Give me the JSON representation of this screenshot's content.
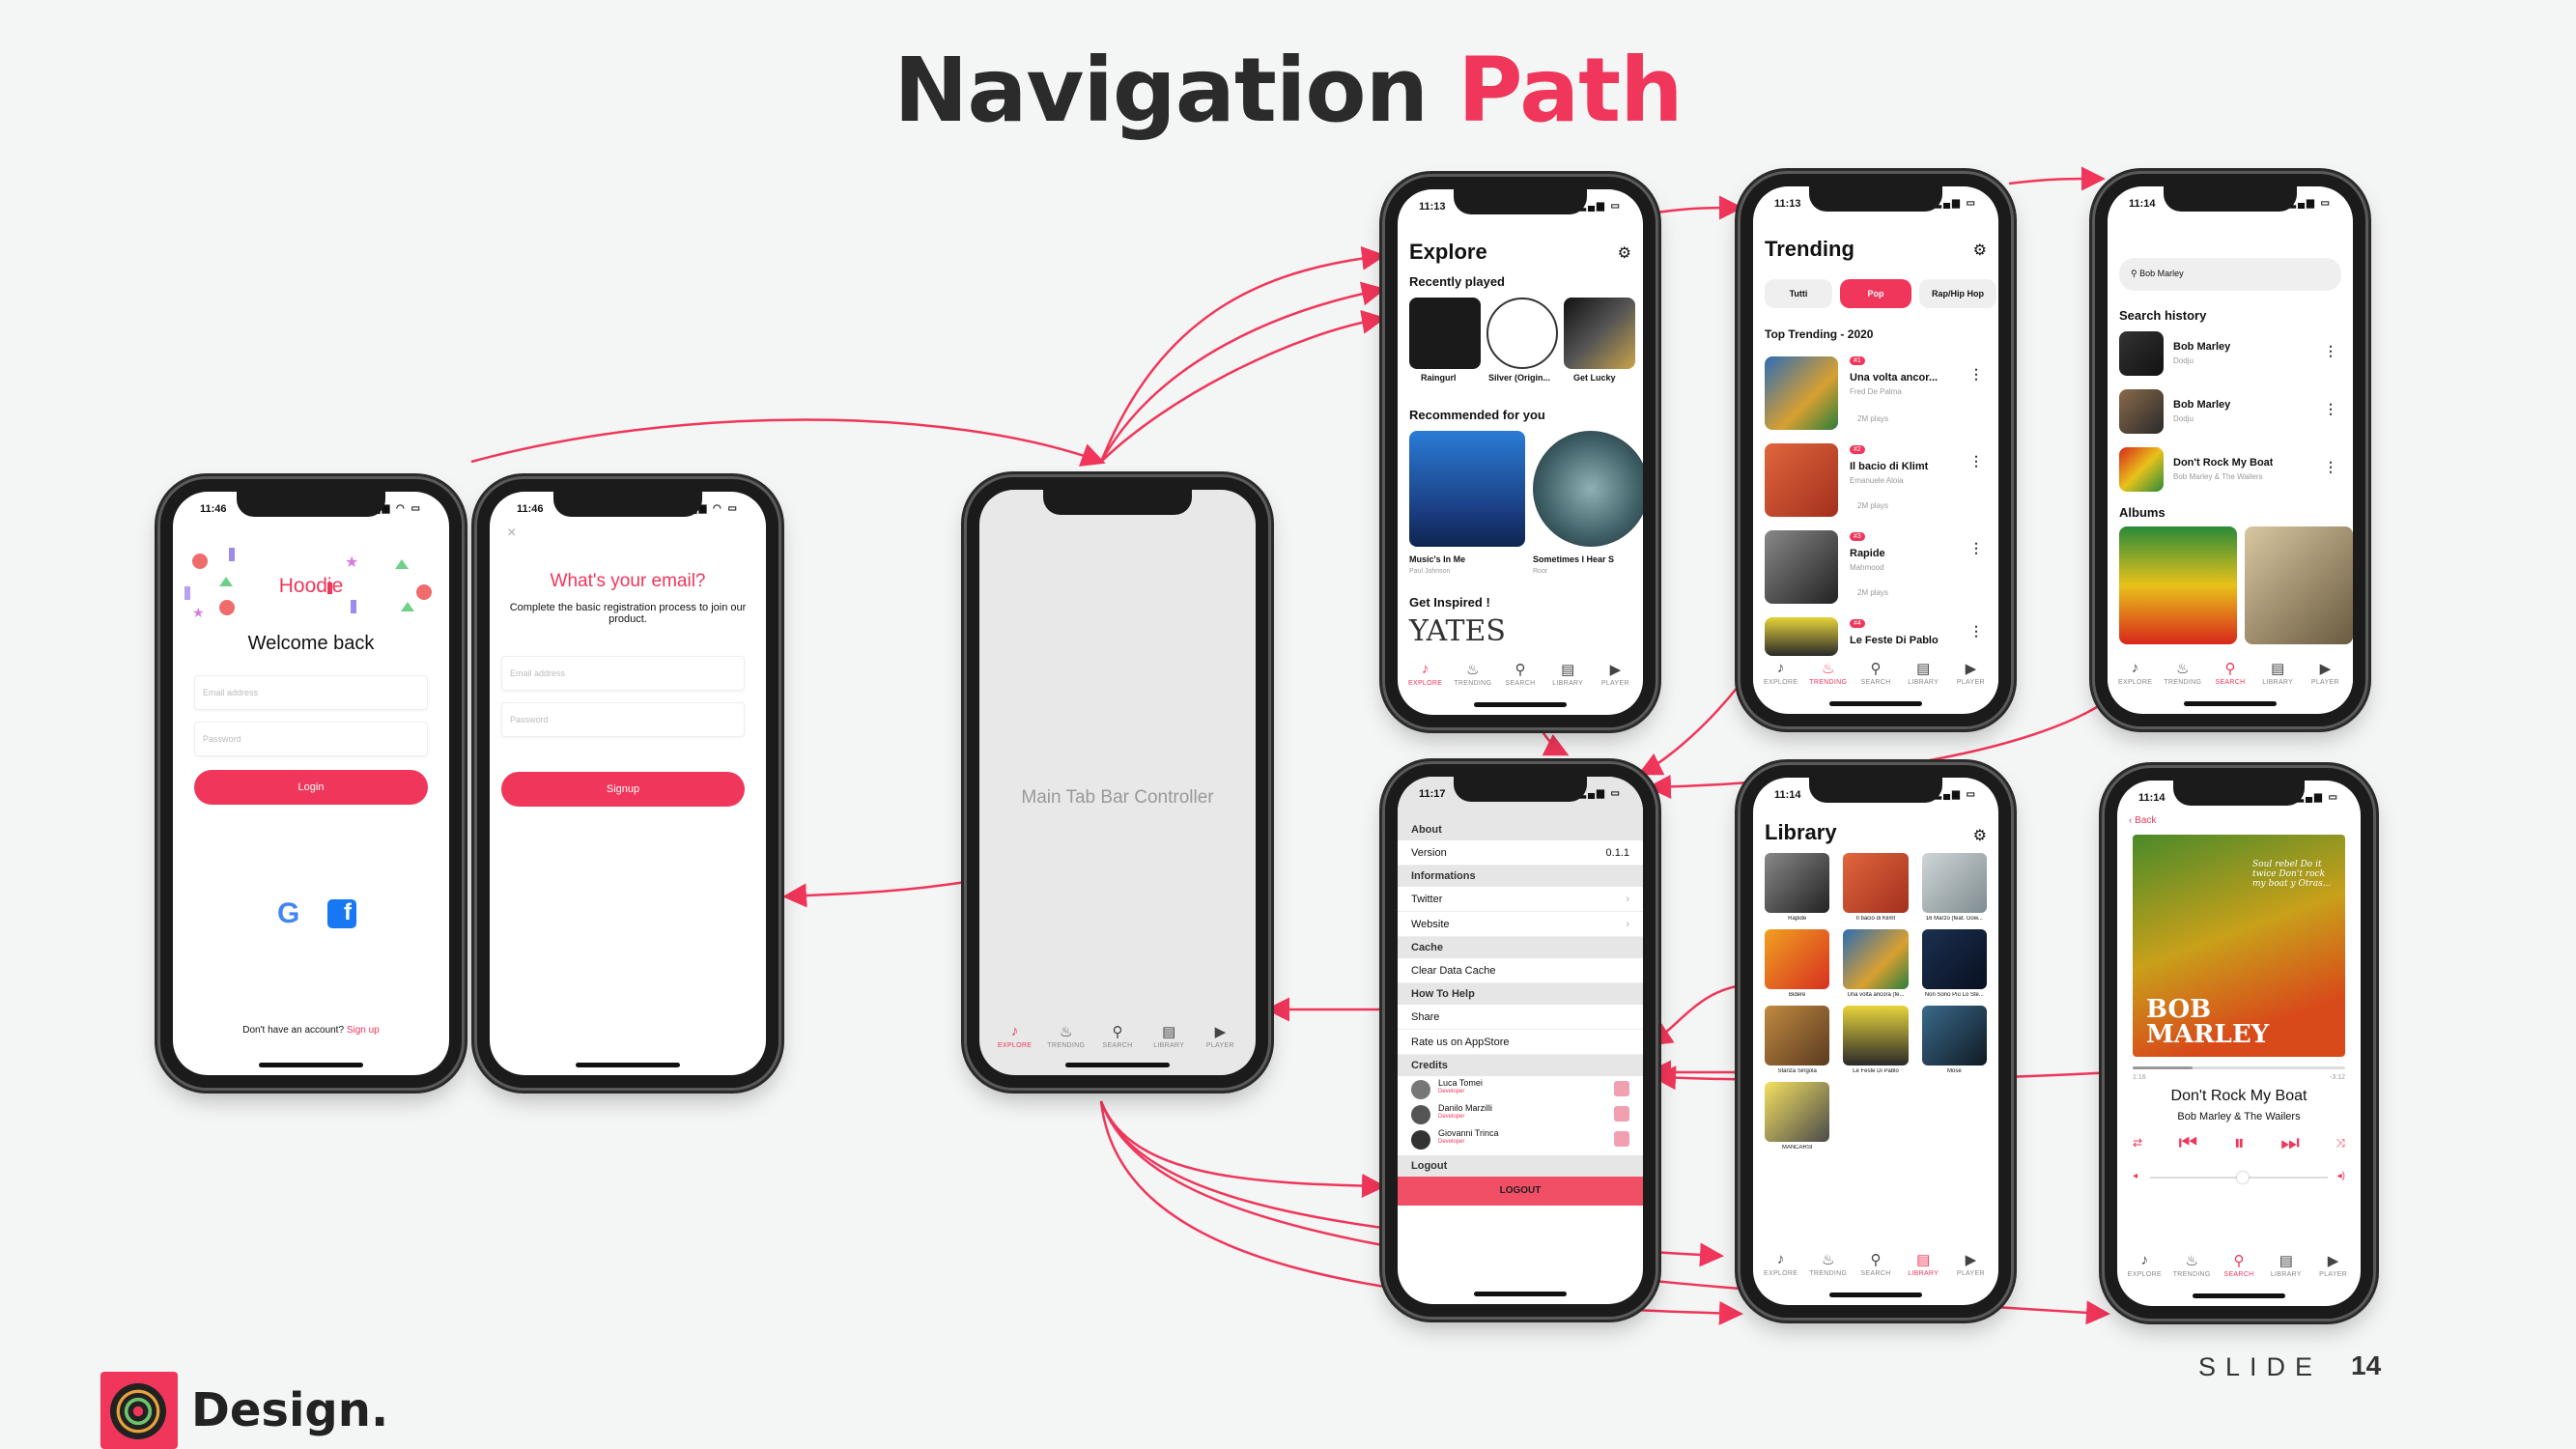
{
  "title": {
    "main": "Navigation",
    "accent": "Path"
  },
  "status_times": {
    "login": "11:46",
    "signup": "11:46",
    "explore": "11:13",
    "trending": "11:13",
    "search": "11:14",
    "settings": "11:17",
    "library": "11:14",
    "player": "11:14"
  },
  "tabs": [
    "EXPLORE",
    "TRENDING",
    "SEARCH",
    "LIBRARY",
    "PLAYER"
  ],
  "login": {
    "app_name": "Hoodie",
    "welcome": "Welcome back",
    "email_placeholder": "Email address",
    "password_placeholder": "Password",
    "login_button": "Login",
    "no_account": "Don't have an account?",
    "signup_link": "Sign up"
  },
  "signup": {
    "close": "×",
    "question": "What's your email?",
    "description": "Complete the basic registration process to join our product.",
    "email_placeholder": "Email address",
    "password_placeholder": "Password",
    "signup_button": "Signup"
  },
  "main_tab": {
    "label": "Main Tab Bar Controller"
  },
  "explore": {
    "title": "Explore",
    "recently_played": "Recently played",
    "recent": [
      "Raingurl",
      "Silver (Origin...",
      "Get Lucky"
    ],
    "recommended": "Recommended for you",
    "rec": [
      {
        "title": "Music's In Me",
        "artist": "Paul Johnson"
      },
      {
        "title": "Sometimes I Hear S",
        "artist": "Roor"
      }
    ],
    "inspired": "Get Inspired !",
    "inspired_text": "YATES"
  },
  "trending": {
    "title": "Trending",
    "chips": [
      "Tutti",
      "Pop",
      "Rap/Hip Hop"
    ],
    "section": "Top Trending - 2020",
    "items": [
      {
        "rank": "#1",
        "title": "Una volta ancor...",
        "artist": "Fred De Palma",
        "plays": "2M plays"
      },
      {
        "rank": "#2",
        "title": "Il bacio di Klimt",
        "artist": "Emanuele Aloia",
        "plays": "2M plays"
      },
      {
        "rank": "#3",
        "title": "Rapide",
        "artist": "Mahmood",
        "plays": "2M plays"
      },
      {
        "rank": "#4",
        "title": "Le Feste Di Pablo",
        "artist": "",
        "plays": ""
      }
    ]
  },
  "search": {
    "query": "Bob Marley",
    "history_title": "Search history",
    "history": [
      {
        "title": "Bob Marley",
        "sub": "Dodju"
      },
      {
        "title": "Bob Marley",
        "sub": "Dodju"
      },
      {
        "title": "Don't Rock My Boat",
        "sub": "Bob Marley & The Wailers"
      }
    ],
    "albums_title": "Albums"
  },
  "settings": {
    "sections": [
      {
        "header": "About",
        "rows": [
          {
            "label": "Version",
            "value": "0.1.1"
          }
        ]
      },
      {
        "header": "Informations",
        "rows": [
          {
            "label": "Twitter",
            "value": "›"
          },
          {
            "label": "Website",
            "value": "›"
          }
        ]
      },
      {
        "header": "Cache",
        "rows": [
          {
            "label": "Clear Data Cache",
            "value": ""
          }
        ]
      },
      {
        "header": "How To Help",
        "rows": [
          {
            "label": "Share",
            "value": ""
          },
          {
            "label": "Rate us on AppStore",
            "value": ""
          }
        ]
      }
    ],
    "credits_header": "Credits",
    "credits": [
      {
        "name": "Luca Tomei",
        "role": "Developer"
      },
      {
        "name": "Danilo Marzilli",
        "role": "Developer"
      },
      {
        "name": "Giovanni Trinca",
        "role": "Developer"
      }
    ],
    "logout_header": "Logout",
    "logout_button": "LOGOUT"
  },
  "library": {
    "title": "Library",
    "items": [
      "Rapide",
      "Il bacio di Klimt",
      "16 Marzo (feat. Gow...",
      "Bidere",
      "Una volta ancora (fe...",
      "Non Sono Più Lo Ste...",
      "Stanza Singola",
      "Le Feste Di Pablo",
      "Mosé",
      "MANCARSI"
    ]
  },
  "player": {
    "back": "Back",
    "elapsed": "1:16",
    "remaining": "-3:12",
    "progress": 0.28,
    "volume": 0.52,
    "song": "Don't Rock My Boat",
    "artist": "Bob Marley & The Wailers",
    "cover_text": "BOB MARLEY",
    "cover_script": "Soul rebel Do it twice Don't rock my boat y Otras..."
  },
  "footer": {
    "brand": "Design.",
    "slide_label": "SLIDE",
    "slide_number": "14"
  },
  "colors": {
    "accent": "#f0365a",
    "background": "#f4f5f5"
  }
}
